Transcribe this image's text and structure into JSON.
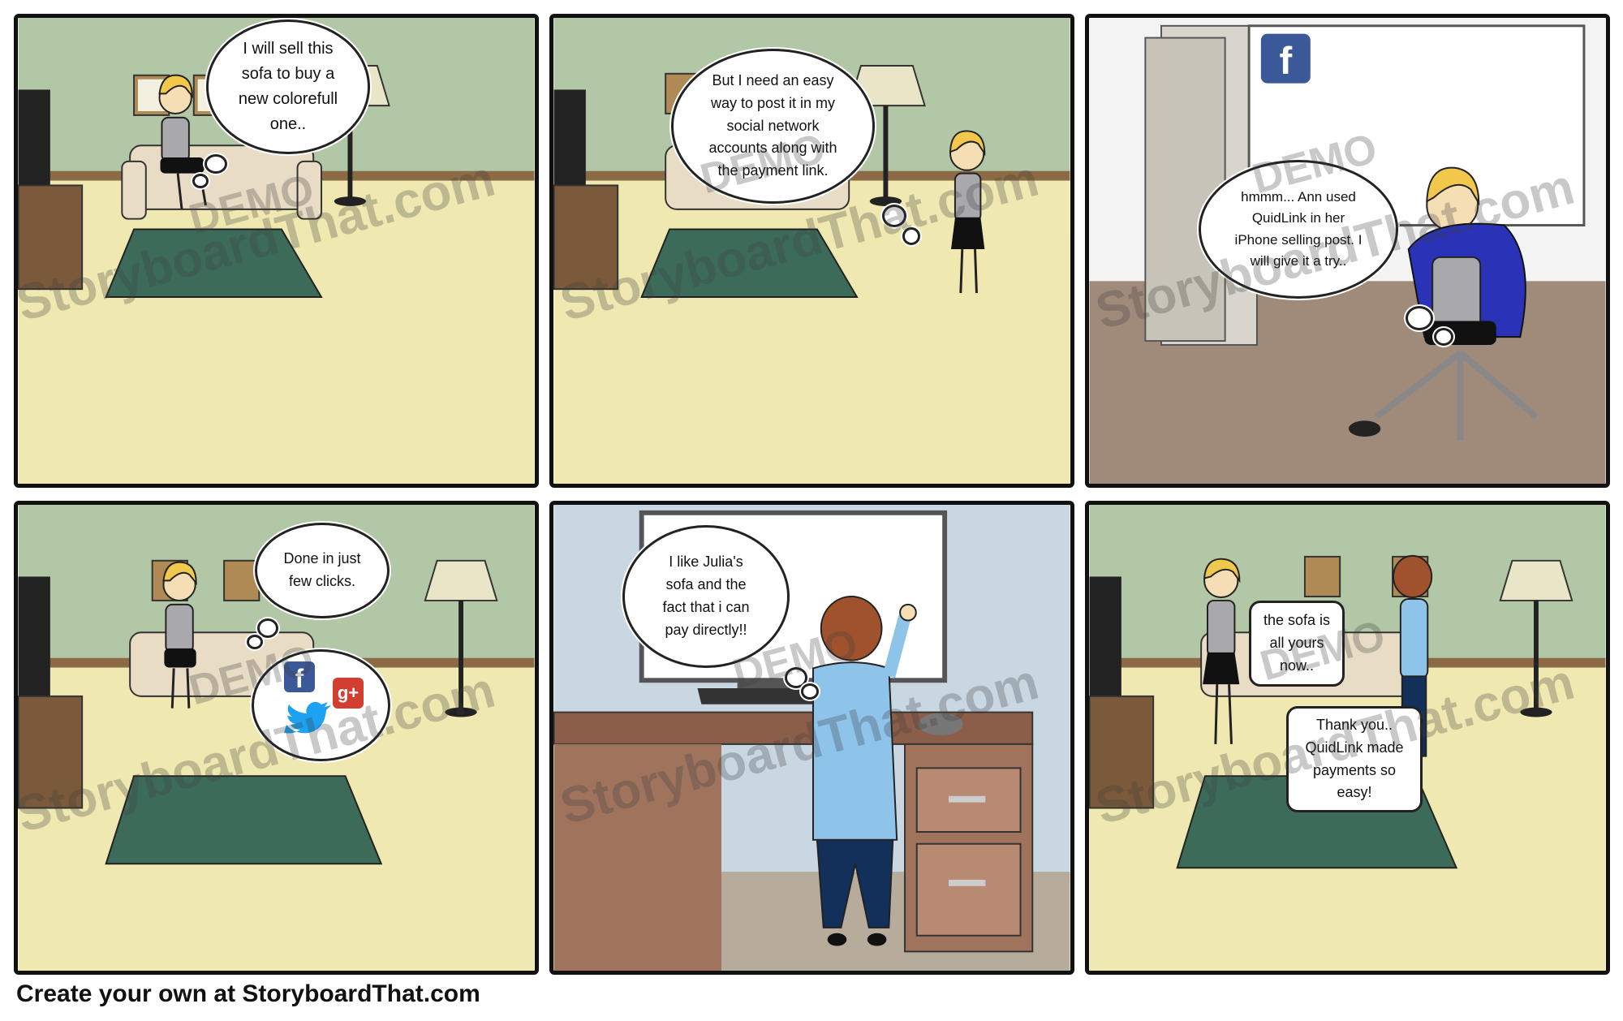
{
  "panels": [
    {
      "bubble": "I will sell this\nsofa to buy a\nnew colorefull\none.."
    },
    {
      "bubble": "But I need an easy\nway to post it in my\nsocial network\naccounts along with\nthe payment link."
    },
    {
      "bubble": "hmmm... Ann used\nQuidLink in her\niPhone selling post. I\nwill give it a try.."
    },
    {
      "bubble": "Done in just\nfew clicks."
    },
    {
      "bubble": "I like Julia's\nsofa and the\nfact that i can\npay directly!!"
    },
    {
      "bubble_a": "the sofa is\nall yours\nnow..",
      "bubble_b": "Thank you..\nQuidLink made\npayments so\neasy!"
    }
  ],
  "watermark": {
    "line1": "DEMO",
    "line2": "StoryboardThat.com"
  },
  "social": {
    "facebook": "f",
    "google_plus": "g+"
  },
  "footer": {
    "text": "Create your own at StoryboardThat.com"
  },
  "colors": {
    "wall": "#b2c7a5",
    "floor": "#efe8b0",
    "rug": "#3d6b5a",
    "office_wall": "#c9d7e3",
    "border": "#111111"
  }
}
